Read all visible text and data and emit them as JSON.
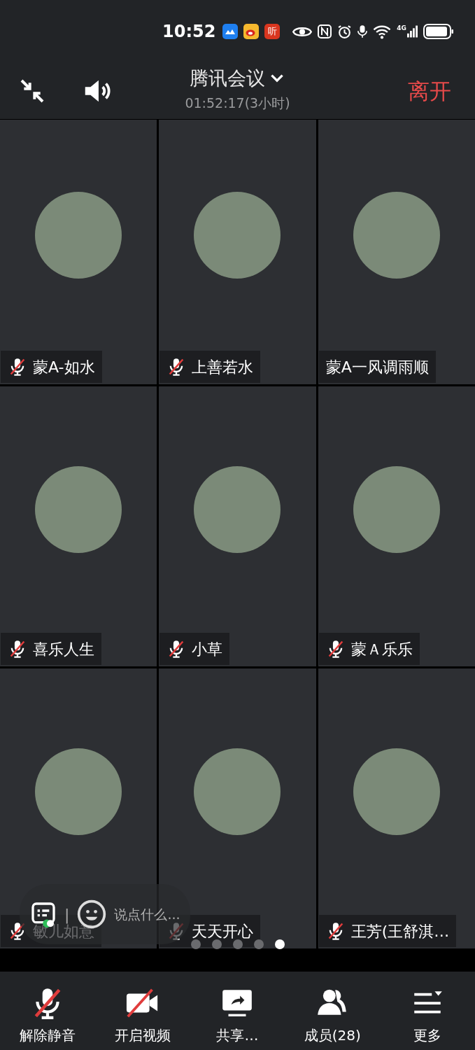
{
  "status_bar": {
    "time": "10:52",
    "app_badges": [
      {
        "kind": "cloud",
        "color": "#1e7ff0"
      },
      {
        "kind": "weibo",
        "color": "#f5b82e"
      },
      {
        "text": "听",
        "kind": "listen",
        "color": "#d9361f"
      }
    ],
    "network": "4G"
  },
  "header": {
    "title": "腾讯会议",
    "duration": "01:52:17(3小时)",
    "leave": "离开"
  },
  "participants": [
    {
      "name": "蒙A-如水",
      "muted": true
    },
    {
      "name": "上善若水",
      "muted": true
    },
    {
      "name": "蒙A一风调雨顺",
      "muted": false
    },
    {
      "name": "喜乐人生",
      "muted": true
    },
    {
      "name": "小草",
      "muted": true
    },
    {
      "name": "蒙Ａ乐乐",
      "muted": true
    },
    {
      "name": "敏儿如意",
      "muted": true
    },
    {
      "name": "天天开心",
      "muted": true
    },
    {
      "name": "王芳(王舒淇…",
      "muted": true
    }
  ],
  "chat_bar": {
    "placeholder": "说点什么...",
    "separator": "|"
  },
  "pages": [
    {
      "selected": false
    },
    {
      "selected": false
    },
    {
      "selected": false
    },
    {
      "selected": false
    },
    {
      "selected": true
    }
  ],
  "toolbar": [
    {
      "kind": "mic",
      "label": "解除静音"
    },
    {
      "kind": "video",
      "label": "开启视频"
    },
    {
      "kind": "share",
      "label": "共享…"
    },
    {
      "kind": "members",
      "label": "成员(28)"
    },
    {
      "kind": "more",
      "label": "更多"
    }
  ]
}
